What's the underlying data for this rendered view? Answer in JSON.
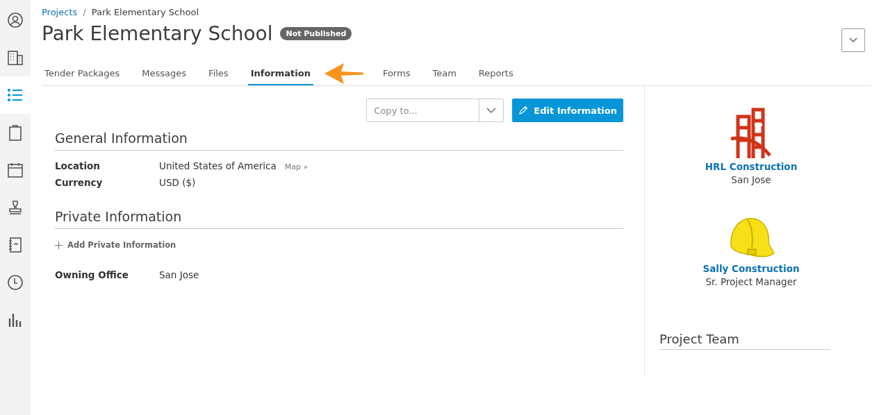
{
  "sidebar": {
    "items": [
      {
        "selected": false
      },
      {
        "selected": false
      },
      {
        "selected": true
      },
      {
        "selected": false
      },
      {
        "selected": false
      },
      {
        "selected": false
      },
      {
        "selected": false
      },
      {
        "selected": false
      },
      {
        "selected": false
      }
    ]
  },
  "breadcrumb": {
    "link": "Projects",
    "separator": "/",
    "current": "Park Elementary School"
  },
  "title": "Park Elementary School",
  "status_badge": "Not Published",
  "tabs": [
    {
      "label": "Tender Packages",
      "selected": false
    },
    {
      "label": "Messages",
      "selected": false
    },
    {
      "label": "Files",
      "selected": false
    },
    {
      "label": "Information",
      "selected": true
    },
    {
      "label": "Forms",
      "selected": false
    },
    {
      "label": "Team",
      "selected": false
    },
    {
      "label": "Reports",
      "selected": false
    }
  ],
  "copy_to": {
    "placeholder": "Copy to..."
  },
  "edit_button": "Edit Information",
  "general": {
    "heading": "General Information",
    "fields": [
      {
        "label": "Location",
        "value": "United States of America",
        "link": "Map »"
      },
      {
        "label": "Currency",
        "value": "USD ($)"
      }
    ]
  },
  "private": {
    "heading": "Private Information",
    "add": "Add Private Information",
    "fields": [
      {
        "label": "Owning Office",
        "value": "San Jose"
      }
    ]
  },
  "companies": [
    {
      "name": "HRL Construction",
      "subtitle": "San Jose"
    },
    {
      "name": "Sally Construction",
      "subtitle": "Sr. Project Manager"
    }
  ],
  "project_team": {
    "heading": "Project Team"
  }
}
